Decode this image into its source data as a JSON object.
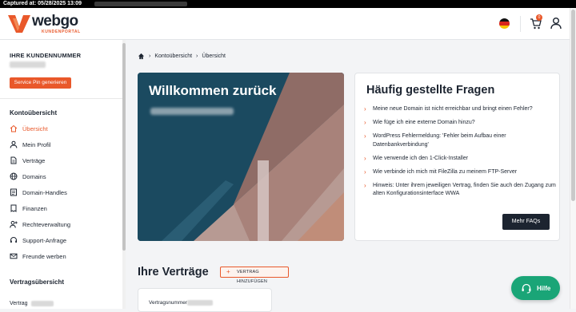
{
  "capture": {
    "label": "Captured at: 05/28/2025 13:09"
  },
  "brand": {
    "name": "webgo",
    "sub": "KUNDENPORTAL",
    "accent": "#e9582a",
    "dark": "#1c2430",
    "help_green": "#1aa577"
  },
  "header": {
    "cart_count": "0",
    "icons": [
      "de-flag-icon",
      "cart-icon",
      "user-icon"
    ]
  },
  "sidebar": {
    "customer_heading": "IHRE KUNDENNUMMER",
    "pin_button": "Service Pin generieren",
    "section_account": "Kontoübersicht",
    "items": [
      {
        "label": "Übersicht",
        "icon": "home-icon",
        "active": true
      },
      {
        "label": "Mein Profil",
        "icon": "user-icon"
      },
      {
        "label": "Verträge",
        "icon": "document-icon"
      },
      {
        "label": "Domains",
        "icon": "globe-icon"
      },
      {
        "label": "Domain-Handles",
        "icon": "id-card-icon"
      },
      {
        "label": "Finanzen",
        "icon": "invoice-icon"
      },
      {
        "label": "Rechteverwaltung",
        "icon": "user-plus-icon"
      },
      {
        "label": "Support-Anfrage",
        "icon": "support-icon"
      },
      {
        "label": "Freunde werben",
        "icon": "mail-icon"
      }
    ],
    "section_contracts": "Vertragsübersicht",
    "contract_row_label": "Vertrag"
  },
  "breadcrumb": {
    "items": [
      "Kontoübersicht",
      "Übersicht"
    ]
  },
  "welcome": {
    "title": "Willkommen zurück"
  },
  "faq": {
    "title": "Häufig gestellte Fragen",
    "items": [
      "Meine neue Domain ist nicht erreichbar und bringt einen Fehler?",
      "Wie füge ich eine externe Domain hinzu?",
      "WordPress Fehlermeldung: 'Fehler beim Aufbau einer Datenbankverbindung'",
      "Wie verwende ich den 1-Click-Installer",
      "Wie verbinde ich mich mit FileZilla zu meinem FTP-Server",
      "Hinweis: Unter ihrem jeweiligen Vertrag, finden Sie auch den Zugang zum alten Konfigurationsinterface WWA"
    ],
    "more_button": "Mehr FAQs"
  },
  "contracts": {
    "title": "Ihre Verträge",
    "add_button": "VERTRAG HINZUFÜGEN",
    "card_label": "Vertragsnummer"
  },
  "help": {
    "label": "Hilfe"
  }
}
